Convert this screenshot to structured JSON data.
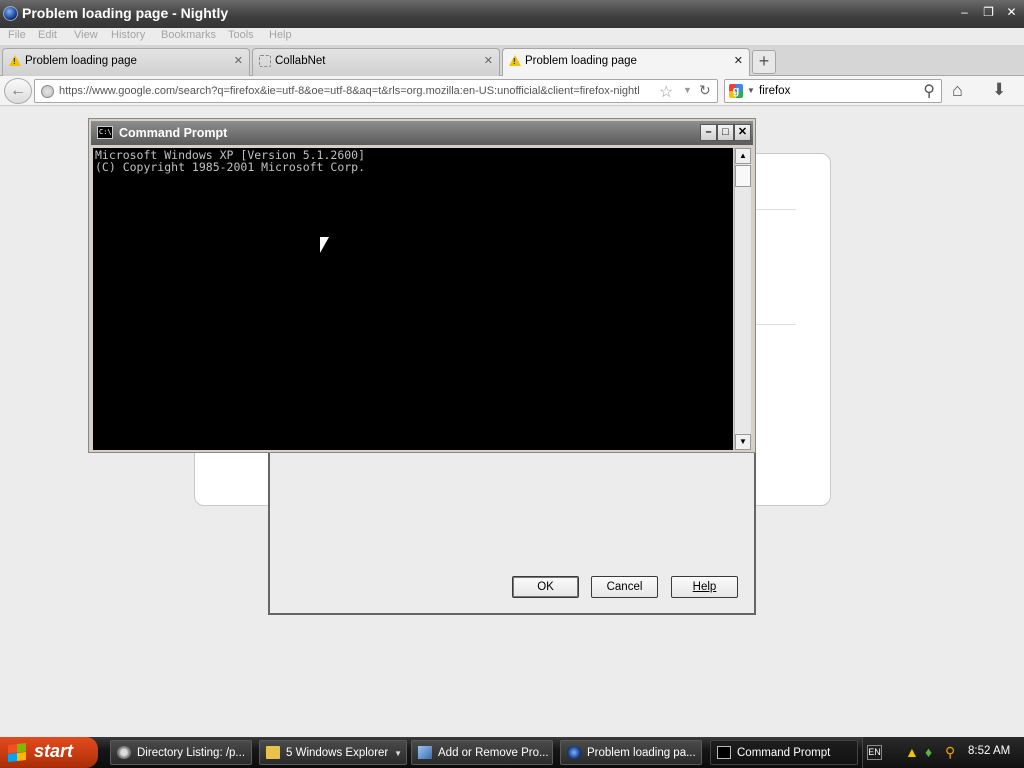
{
  "window": {
    "title": "Problem loading page - Nightly"
  },
  "menubar": [
    "File",
    "Edit",
    "View",
    "History",
    "Bookmarks",
    "Tools",
    "Help"
  ],
  "tabs": [
    {
      "label": "Problem loading page",
      "icon": "warning-icon",
      "active": false
    },
    {
      "label": "CollabNet",
      "icon": "blank-page-icon",
      "active": false
    },
    {
      "label": "Problem loading page",
      "icon": "warning-icon",
      "active": true
    }
  ],
  "navbar": {
    "url": "https://www.google.com/search?q=firefox&ie=utf-8&oe=utf-8&aq=t&rls=org.mozilla:en-US:unofficial&client=firefox-nightl",
    "search_engine": "google",
    "search_query": "firefox"
  },
  "dialog": {
    "ok_label": "OK",
    "cancel_label": "Cancel",
    "help_label": "Help"
  },
  "cmd": {
    "title": "Command Prompt",
    "icon_text": "C:\\",
    "lines": [
      "Microsoft Windows XP [Version 5.1.2600]",
      "(C) Copyright 1985-2001 Microsoft Corp."
    ]
  },
  "taskbar": {
    "start_label": "start",
    "items": [
      {
        "label": "Directory Listing: /p...",
        "icon": "gear-folder-icon",
        "active": false
      },
      {
        "label": "5 Windows Explorer",
        "icon": "folder-icon",
        "active": false
      },
      {
        "label": "Add or Remove Pro...",
        "icon": "install-icon",
        "active": false
      },
      {
        "label": "Problem loading pa...",
        "icon": "nightly-icon",
        "active": false
      },
      {
        "label": "Command Prompt",
        "icon": "cmd-icon",
        "active": true
      }
    ],
    "tray": {
      "language": "EN",
      "clock": "8:52 AM"
    }
  },
  "colors": {
    "warning": "#f2c200",
    "start_button": "#d8421a",
    "taskbar": "#161616",
    "console_bg": "#000000",
    "console_fg": "#c0c0c0"
  }
}
